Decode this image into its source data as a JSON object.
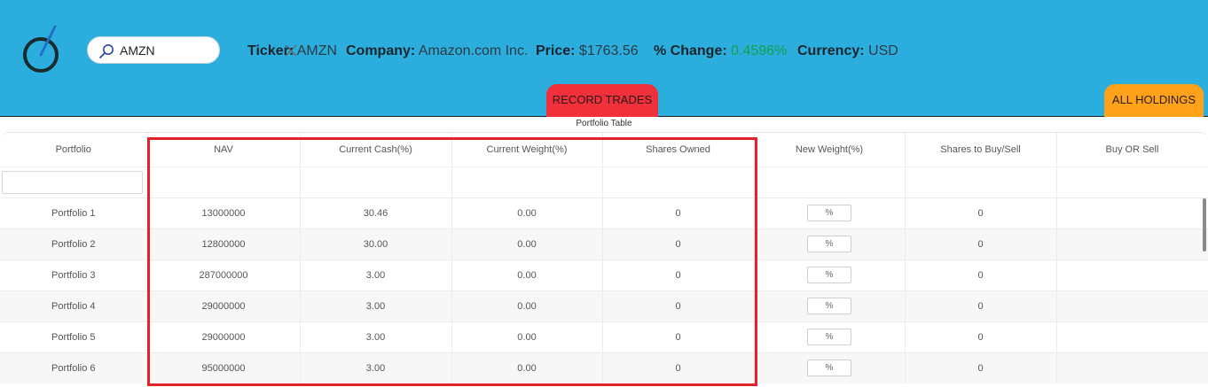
{
  "search": {
    "value": "AMZN"
  },
  "quote": {
    "ticker_label": "Ticker:",
    "ticker": "AMZN",
    "company_label": "Company:",
    "company": "Amazon.com Inc.",
    "price_label": "Price:",
    "price": "$1763.56",
    "change_label": "% Change:",
    "change": "0.4596%",
    "currency_label": "Currency:",
    "currency": "USD"
  },
  "tabs": {
    "record": "RECORD TRADES",
    "holdings": "ALL HOLDINGS"
  },
  "table": {
    "caption": "Portfolio Table",
    "headers": [
      "Portfolio",
      "NAV",
      "Current Cash(%)",
      "Current Weight(%)",
      "Shares Owned",
      "New Weight(%)",
      "Shares to Buy/Sell",
      "Buy OR Sell"
    ],
    "weight_placeholder": "%",
    "rows": [
      {
        "portfolio": "Portfolio 1",
        "nav": "13000000",
        "cash": "30.46",
        "weight": "0.00",
        "shares": "0",
        "buy_sell_shares": "0",
        "buy_or_sell": ""
      },
      {
        "portfolio": "Portfolio 2",
        "nav": "12800000",
        "cash": "30.00",
        "weight": "0.00",
        "shares": "0",
        "buy_sell_shares": "0",
        "buy_or_sell": ""
      },
      {
        "portfolio": "Portfolio 3",
        "nav": "287000000",
        "cash": "3.00",
        "weight": "0.00",
        "shares": "0",
        "buy_sell_shares": "0",
        "buy_or_sell": ""
      },
      {
        "portfolio": "Portfolio 4",
        "nav": "29000000",
        "cash": "3.00",
        "weight": "0.00",
        "shares": "0",
        "buy_sell_shares": "0",
        "buy_or_sell": ""
      },
      {
        "portfolio": "Portfolio 5",
        "nav": "29000000",
        "cash": "3.00",
        "weight": "0.00",
        "shares": "0",
        "buy_sell_shares": "0",
        "buy_or_sell": ""
      },
      {
        "portfolio": "Portfolio 6",
        "nav": "95000000",
        "cash": "3.00",
        "weight": "0.00",
        "shares": "0",
        "buy_sell_shares": "0",
        "buy_or_sell": ""
      }
    ]
  },
  "colors": {
    "header_bg": "#2baede",
    "record_tab": "#f0303a",
    "holdings_tab": "#fea21a",
    "positive_change": "#14a04a",
    "highlight": "#e0222a"
  },
  "icons": {
    "logo": "gauge-logo-icon",
    "search": "search-icon",
    "clear": "close-icon"
  }
}
